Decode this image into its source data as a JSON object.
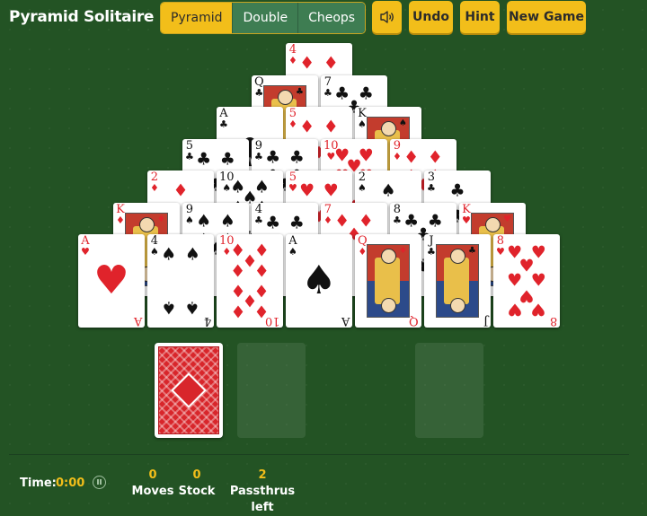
{
  "app": {
    "title": "Pyramid Solitaire"
  },
  "modes": [
    {
      "label": "Pyramid",
      "active": true
    },
    {
      "label": "Double",
      "active": false
    },
    {
      "label": "Cheops",
      "active": false
    }
  ],
  "toolbar": {
    "sound_icon": "speaker-icon",
    "undo_label": "Undo",
    "hint_label": "Hint",
    "new_game_label": "New Game"
  },
  "colors": {
    "felt": "#235324",
    "accent": "#f2be1a",
    "red_suit": "#e0232b",
    "card_back": "#d8262b"
  },
  "pyramid": {
    "rows": [
      [
        {
          "rank": "4",
          "suit": "♦"
        }
      ],
      [
        {
          "rank": "Q",
          "suit": "♣"
        },
        {
          "rank": "7",
          "suit": "♣"
        }
      ],
      [
        {
          "rank": "A",
          "suit": "♣"
        },
        {
          "rank": "5",
          "suit": "♦"
        },
        {
          "rank": "K",
          "suit": "♠"
        }
      ],
      [
        {
          "rank": "5",
          "suit": "♣"
        },
        {
          "rank": "9",
          "suit": "♣"
        },
        {
          "rank": "10",
          "suit": "♥"
        },
        {
          "rank": "9",
          "suit": "♦"
        }
      ],
      [
        {
          "rank": "2",
          "suit": "♦"
        },
        {
          "rank": "10",
          "suit": "♠"
        },
        {
          "rank": "5",
          "suit": "♥"
        },
        {
          "rank": "2",
          "suit": "♠"
        },
        {
          "rank": "3",
          "suit": "♣"
        }
      ],
      [
        {
          "rank": "K",
          "suit": "♦"
        },
        {
          "rank": "9",
          "suit": "♠"
        },
        {
          "rank": "4",
          "suit": "♣"
        },
        {
          "rank": "7",
          "suit": "♦"
        },
        {
          "rank": "8",
          "suit": "♣"
        },
        {
          "rank": "K",
          "suit": "♥"
        }
      ],
      [
        {
          "rank": "A",
          "suit": "♥"
        },
        {
          "rank": "4",
          "suit": "♠"
        },
        {
          "rank": "10",
          "suit": "♦"
        },
        {
          "rank": "A",
          "suit": "♠"
        },
        {
          "rank": "Q",
          "suit": "♦"
        },
        {
          "rank": "J",
          "suit": "♣"
        },
        {
          "rank": "8",
          "suit": "♥"
        }
      ]
    ]
  },
  "stock": {
    "icon": "card-back"
  },
  "status": {
    "time_label": "Time:",
    "time_value": "0:00",
    "moves_value": "0",
    "moves_label": "Moves",
    "stock_value": "0",
    "stock_label": "Stock",
    "passthrus_value": "2",
    "passthrus_label": "Passthrus left"
  }
}
